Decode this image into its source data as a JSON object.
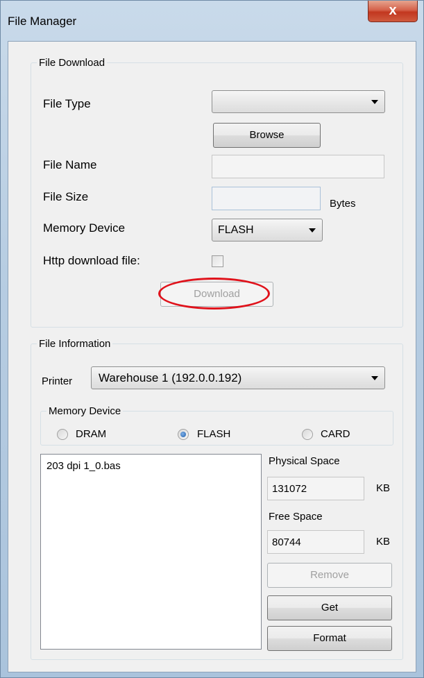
{
  "window": {
    "title": "File Manager",
    "close_label": "x"
  },
  "download": {
    "group_label": "File Download",
    "file_type_label": "File Type",
    "file_type_value": "",
    "browse_label": "Browse",
    "file_name_label": "File Name",
    "file_name_value": "",
    "file_size_label": "File Size",
    "file_size_value": "",
    "bytes_label": "Bytes",
    "memory_device_label": "Memory Device",
    "memory_device_value": "FLASH",
    "http_label": "Http download file:",
    "http_checked": false,
    "download_label": "Download",
    "highlight_color": "#e0121b"
  },
  "info": {
    "group_label": "File Information",
    "printer_label": "Printer",
    "printer_value": "Warehouse 1 (192.0.0.192)",
    "memory_group_label": "Memory Device",
    "radios": [
      {
        "label": "DRAM",
        "selected": false
      },
      {
        "label": "FLASH",
        "selected": true
      },
      {
        "label": "CARD",
        "selected": false
      }
    ],
    "files": [
      "203 dpi 1_0.bas"
    ],
    "physical_label": "Physical Space",
    "physical_value": "131072",
    "physical_unit": "KB",
    "free_label": "Free Space",
    "free_value": "80744",
    "free_unit": "KB",
    "remove_label": "Remove",
    "get_label": "Get",
    "format_label": "Format"
  }
}
